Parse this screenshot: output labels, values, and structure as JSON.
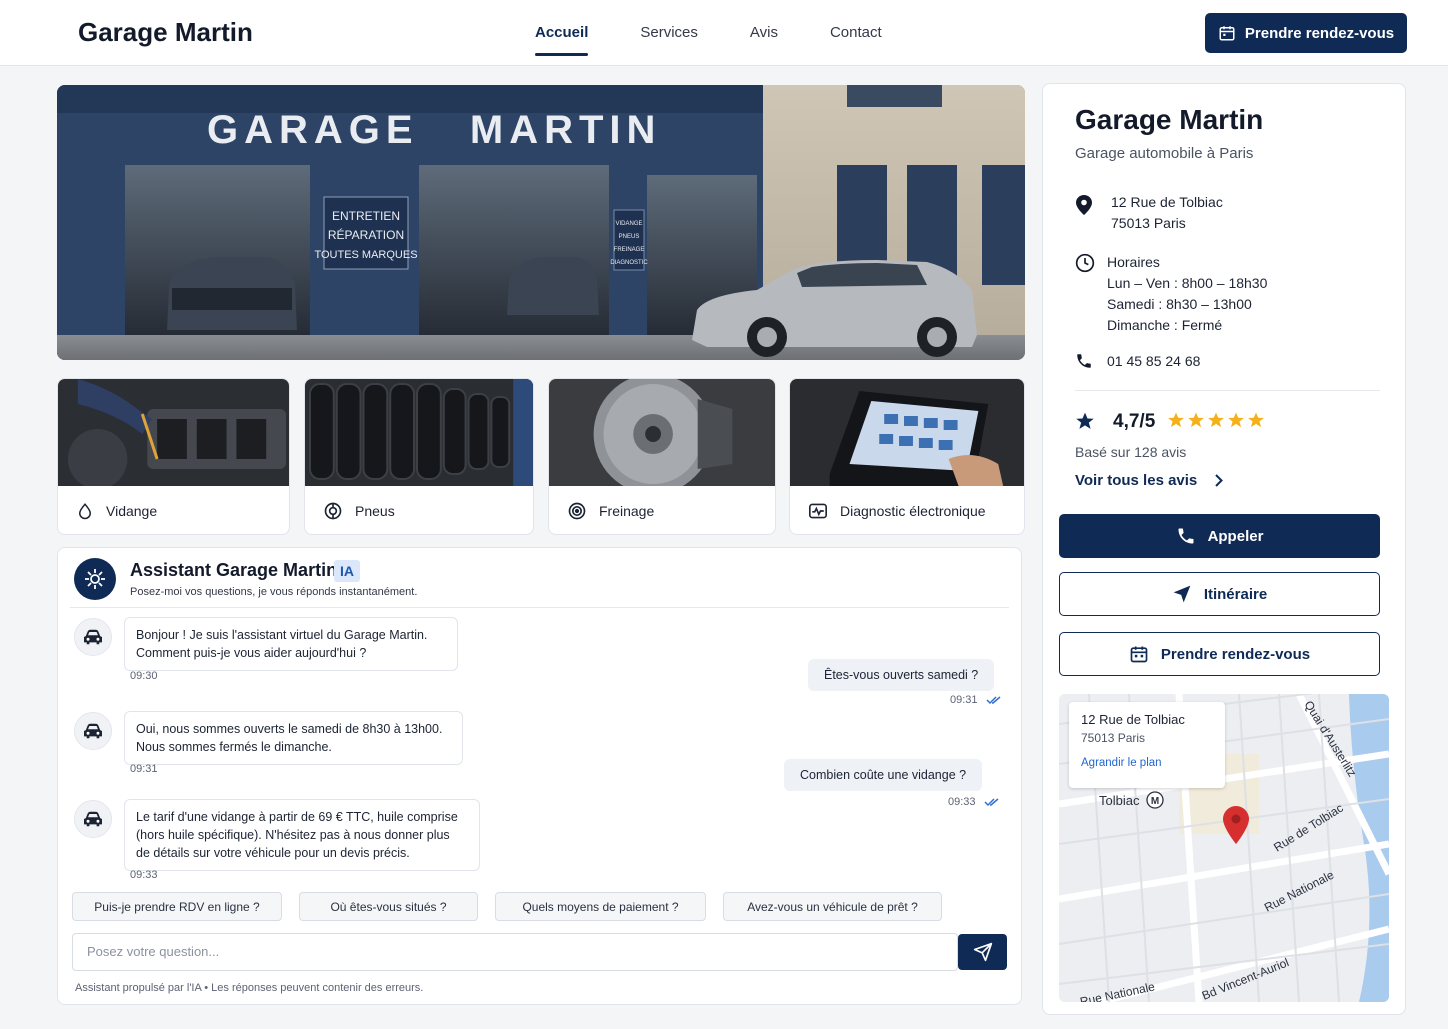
{
  "header": {
    "brand": "Garage Martin",
    "nav": [
      "Accueil",
      "Services",
      "Avis",
      "Contact"
    ],
    "cta": "Prendre rendez-vous"
  },
  "hero": {
    "sign": "GARAGE   MARTIN",
    "panel": [
      "ENTRETIEN",
      "RÉPARATION",
      "TOUTES MARQUES"
    ],
    "small_panel": [
      "VIDANGE",
      "PNEUS",
      "FREINAGE",
      "DIAGNOSTIC"
    ]
  },
  "services": [
    {
      "label": "Vidange",
      "icon": "droplet-icon"
    },
    {
      "label": "Pneus",
      "icon": "tire-icon"
    },
    {
      "label": "Freinage",
      "icon": "brake-disc-icon"
    },
    {
      "label": "Diagnostic électronique",
      "icon": "diagnostic-icon"
    }
  ],
  "chat": {
    "title": "Assistant Garage Martin",
    "badge": "IA",
    "subtitle": "Posez-moi vos questions, je vous réponds instantanément.",
    "messages": [
      {
        "from": "bot",
        "lines": [
          "Bonjour ! Je suis l'assistant virtuel du Garage Martin.",
          "Comment puis-je vous aider aujourd'hui ?"
        ],
        "time": "09:30"
      },
      {
        "from": "user",
        "text": "Êtes-vous ouverts samedi ?",
        "time": "09:31"
      },
      {
        "from": "bot",
        "lines": [
          "Oui, nous sommes ouverts le samedi de 8h30 à 13h00.",
          "Nous sommes fermés le dimanche."
        ],
        "time": "09:31"
      },
      {
        "from": "user",
        "text": "Combien coûte une vidange ?",
        "time": "09:33"
      },
      {
        "from": "bot",
        "lines": [
          "Le tarif d'une vidange à partir de 69 € TTC, huile comprise",
          "(hors huile spécifique). N'hésitez pas à nous donner plus",
          "de détails sur votre véhicule pour un devis précis."
        ],
        "time": "09:33"
      }
    ],
    "suggestions": [
      "Puis-je prendre RDV en ligne ?",
      "Où êtes-vous situés  ?",
      "Quels moyens de paiement ?",
      "Avez-vous un véhicule de prêt ?"
    ],
    "input_placeholder": "Posez votre question...",
    "footer": "Assistant propulsé par l'IA  •  Les réponses peuvent contenir des erreurs."
  },
  "sidebar": {
    "title": "Garage Martin",
    "subtitle": "Garage automobile à Paris",
    "address": [
      "12 Rue de Tolbiac",
      "75013 Paris"
    ],
    "hours_title": "Horaires",
    "hours": [
      "Lun – Ven : 8h00 – 18h30",
      "Samedi : 8h30 – 13h00",
      "Dimanche : Fermé"
    ],
    "phone": "01 45 85 24 68",
    "rating": "4,7/5",
    "stars": 5,
    "reviews_count": "Basé sur 128 avis",
    "all_reviews": "Voir tous les avis",
    "btn_call": "Appeler",
    "btn_route": "Itinéraire",
    "btn_rdv": "Prendre rendez-vous",
    "colors": {
      "navy": "#0f2a55",
      "star": "#f5b01a",
      "pin": "#d62f2f"
    }
  },
  "map": {
    "card": [
      "12 Rue de Tolbiac",
      "75013 Paris",
      "Agrandir le plan"
    ],
    "labels": {
      "metro": "Tolbiac",
      "metro_symbol": "M",
      "quai": "Quai d'Austerlitz",
      "rue_tolbiac": "Rue de Tolbiac",
      "rue_nationale": "Rue Nationale",
      "bd_vincent": "Bd Vincent-Auriol",
      "bottom": "Rue Nationale"
    }
  }
}
